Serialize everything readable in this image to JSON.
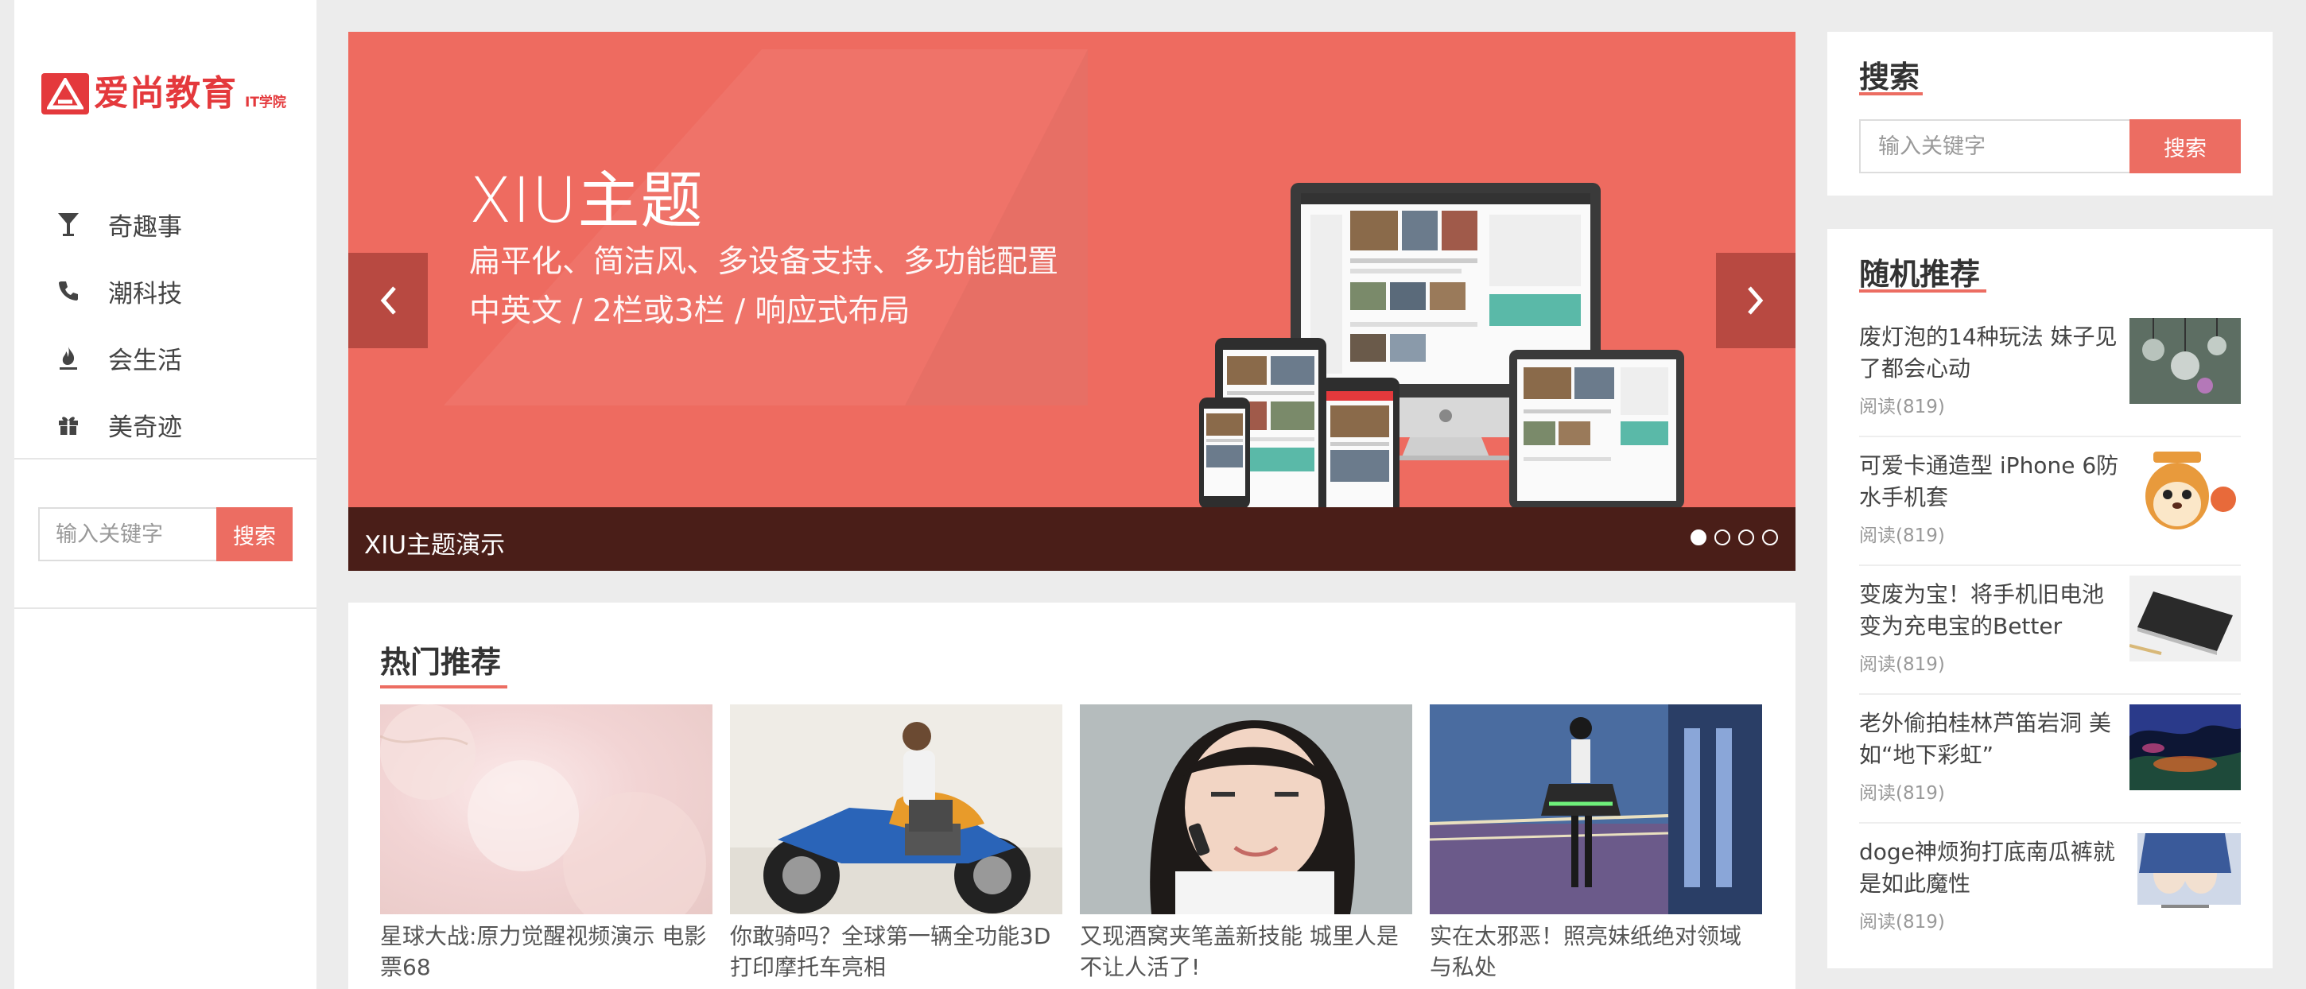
{
  "sidebar": {
    "logo_text": "爱尚教育",
    "logo_sub": "IT学院",
    "nav": [
      {
        "label": "奇趣事",
        "icon": "glass-icon"
      },
      {
        "label": "潮科技",
        "icon": "phone-icon"
      },
      {
        "label": "会生活",
        "icon": "fire-icon"
      },
      {
        "label": "美奇迹",
        "icon": "gift-icon"
      }
    ],
    "search": {
      "placeholder": "输入关键字",
      "button": "搜索"
    }
  },
  "slider": {
    "title": "XIU主题",
    "line1": "扁平化、简洁风、多设备支持、多功能配置",
    "line2": "中英文 / 2栏或3栏 / 响应式布局",
    "caption": "XIU主题演示",
    "dots": 4,
    "active_dot": 1,
    "color": "#ee6b60"
  },
  "hot": {
    "title": "热门推荐",
    "items": [
      {
        "caption": "星球大战:原力觉醒视频演示 电影票68"
      },
      {
        "caption": "你敢骑吗？全球第一辆全功能3D打印摩托车亮相"
      },
      {
        "caption": "又现酒窝夹笔盖新技能 城里人是不让人活了!"
      },
      {
        "caption": "实在太邪恶！照亮妹纸绝对领域与私处"
      }
    ]
  },
  "right": {
    "search": {
      "title": "搜索",
      "placeholder": "输入关键字",
      "button": "搜索"
    },
    "random": {
      "title": "随机推荐",
      "items": [
        {
          "title": "废灯泡的14种玩法 妹子见了都会心动",
          "meta": "阅读(819)"
        },
        {
          "title": "可爱卡通造型 iPhone 6防水手机套",
          "meta": "阅读(819)"
        },
        {
          "title": "变废为宝！将手机旧电池变为充电宝的Better",
          "meta": "阅读(819)"
        },
        {
          "title": "老外偷拍桂林芦笛岩洞 美如“地下彩虹”",
          "meta": "阅读(819)"
        },
        {
          "title": "doge神烦狗打底南瓜裤就是如此魔性",
          "meta": "阅读(819)"
        }
      ]
    }
  },
  "accent_color": "#ec6d62"
}
